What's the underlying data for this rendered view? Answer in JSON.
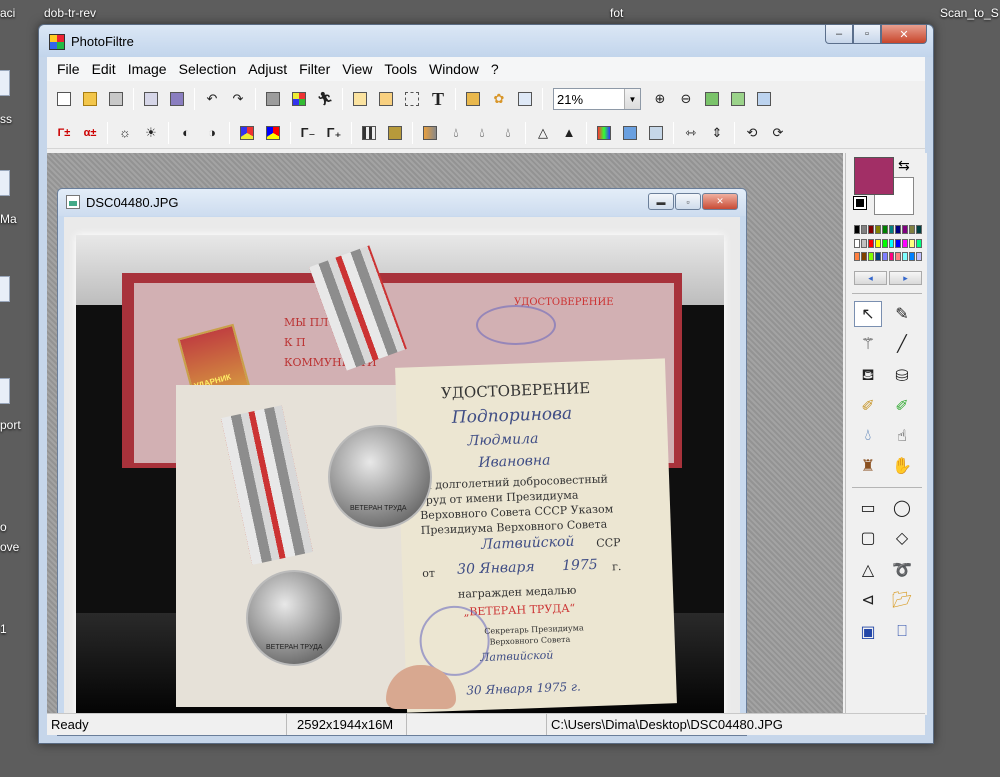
{
  "desktop": {
    "top_labels": [
      "aci",
      "dob-tr-rev",
      "fot",
      "Scan_to_S"
    ],
    "side_labels": [
      "ss",
      "Ma",
      "port",
      "o",
      "ove",
      "1"
    ]
  },
  "window": {
    "title": "PhotoFiltre",
    "controls": {
      "minimize": "‒",
      "maximize": "▫",
      "close": "✕"
    }
  },
  "menu": [
    "File",
    "Edit",
    "Image",
    "Selection",
    "Adjust",
    "Filter",
    "View",
    "Tools",
    "Window",
    "?"
  ],
  "toolbar": {
    "zoom_value": "21%",
    "zoom_arrow": "▼",
    "text_tool_glyph": "T"
  },
  "document": {
    "title": "DSC04480.JPG",
    "controls": {
      "minimize": "▬",
      "maximize": "▫",
      "close": "✕"
    }
  },
  "photo_text": {
    "cover_left": [
      "МЫ ПЛ",
      "К П",
      "КОММУНИСТИ"
    ],
    "cover_right_header": "УДОСТОВЕРЕНИЕ",
    "cert_title": "УДОСТОВЕРЕНИЕ",
    "cert_surname": "Подпоринова",
    "cert_name": "Людмила",
    "cert_patronymic": "Ивановна",
    "cert_line1": "за долголетний добросовестный",
    "cert_line2": "труд от имени Президиума",
    "cert_line3": "Верховного Совета СССР Указом",
    "cert_line4": "Президиума Верховного Совета",
    "cert_republic": "Латвийской",
    "cert_ssr": "ССР",
    "cert_from": "от",
    "cert_date": "30 Января",
    "cert_year": "1975",
    "cert_g": "г.",
    "cert_awarded": "награжден медалью",
    "cert_medal": "„ВЕТЕРАН ТРУДА“",
    "cert_secretary": "Секретарь Президиума",
    "cert_council": "Верховного Совета",
    "cert_bottom_date": "30 Января 1975 г.",
    "medal_text": "ВЕТЕРАН ТРУДА",
    "badge_text": "УДАРНИК"
  },
  "panel": {
    "foreground_color": "#a22f66",
    "background_color": "#ffffff",
    "swap_glyph": "⇆",
    "scroll_left": "◂",
    "scroll_right": "▸",
    "palette": [
      "#000000",
      "#808080",
      "#800000",
      "#808000",
      "#008000",
      "#008080",
      "#000080",
      "#800080",
      "#808040",
      "#004040",
      "#ffffff",
      "#c0c0c0",
      "#ff0000",
      "#ffff00",
      "#00ff00",
      "#00ffff",
      "#0000ff",
      "#ff00ff",
      "#ffff80",
      "#00ff80",
      "#ff8040",
      "#804000",
      "#80ff00",
      "#004080",
      "#8080ff",
      "#ff0080",
      "#ff8080",
      "#80ffff",
      "#0080ff",
      "#c0c0ff"
    ]
  },
  "status": {
    "state": "Ready",
    "image_info": "2592x1944x16M",
    "file_path": "C:\\Users\\Dima\\Desktop\\DSC04480.JPG"
  },
  "colors": {
    "accent": "#a22f66",
    "window_chrome": "#c6d6ea"
  }
}
